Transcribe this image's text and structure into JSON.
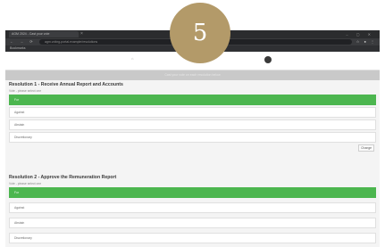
{
  "step_badge": "5",
  "browser": {
    "tab_title": "AGM 2024 - Cast your vote",
    "tab_close": "×",
    "window_controls": "– ▢ ✕",
    "nav_icons": "← → ⟳",
    "url": "agm.voting-portal.example/resolutions",
    "nav_right": "☆ ●  ⋮",
    "bookmark": "Bookmarks"
  },
  "header": {
    "left_mark": "⌂",
    "banner_text": "Cast your vote on each resolution below"
  },
  "resolutions": [
    {
      "title": "Resolution 1 - Receive Annual Report and Accounts",
      "subtitle": "Vote - please select one",
      "options": [
        "For",
        "Against",
        "Abstain",
        "Discretionary"
      ],
      "selected": 0,
      "change_label": "Change"
    },
    {
      "title": "Resolution 2 - Approve the Remuneration Report",
      "subtitle": "Vote - please select one",
      "options": [
        "For",
        "Against",
        "Abstain",
        "Discretionary"
      ],
      "selected": 0
    }
  ],
  "colors": {
    "selected_green": "#4cb64f",
    "badge_gold": "#b39a69"
  }
}
